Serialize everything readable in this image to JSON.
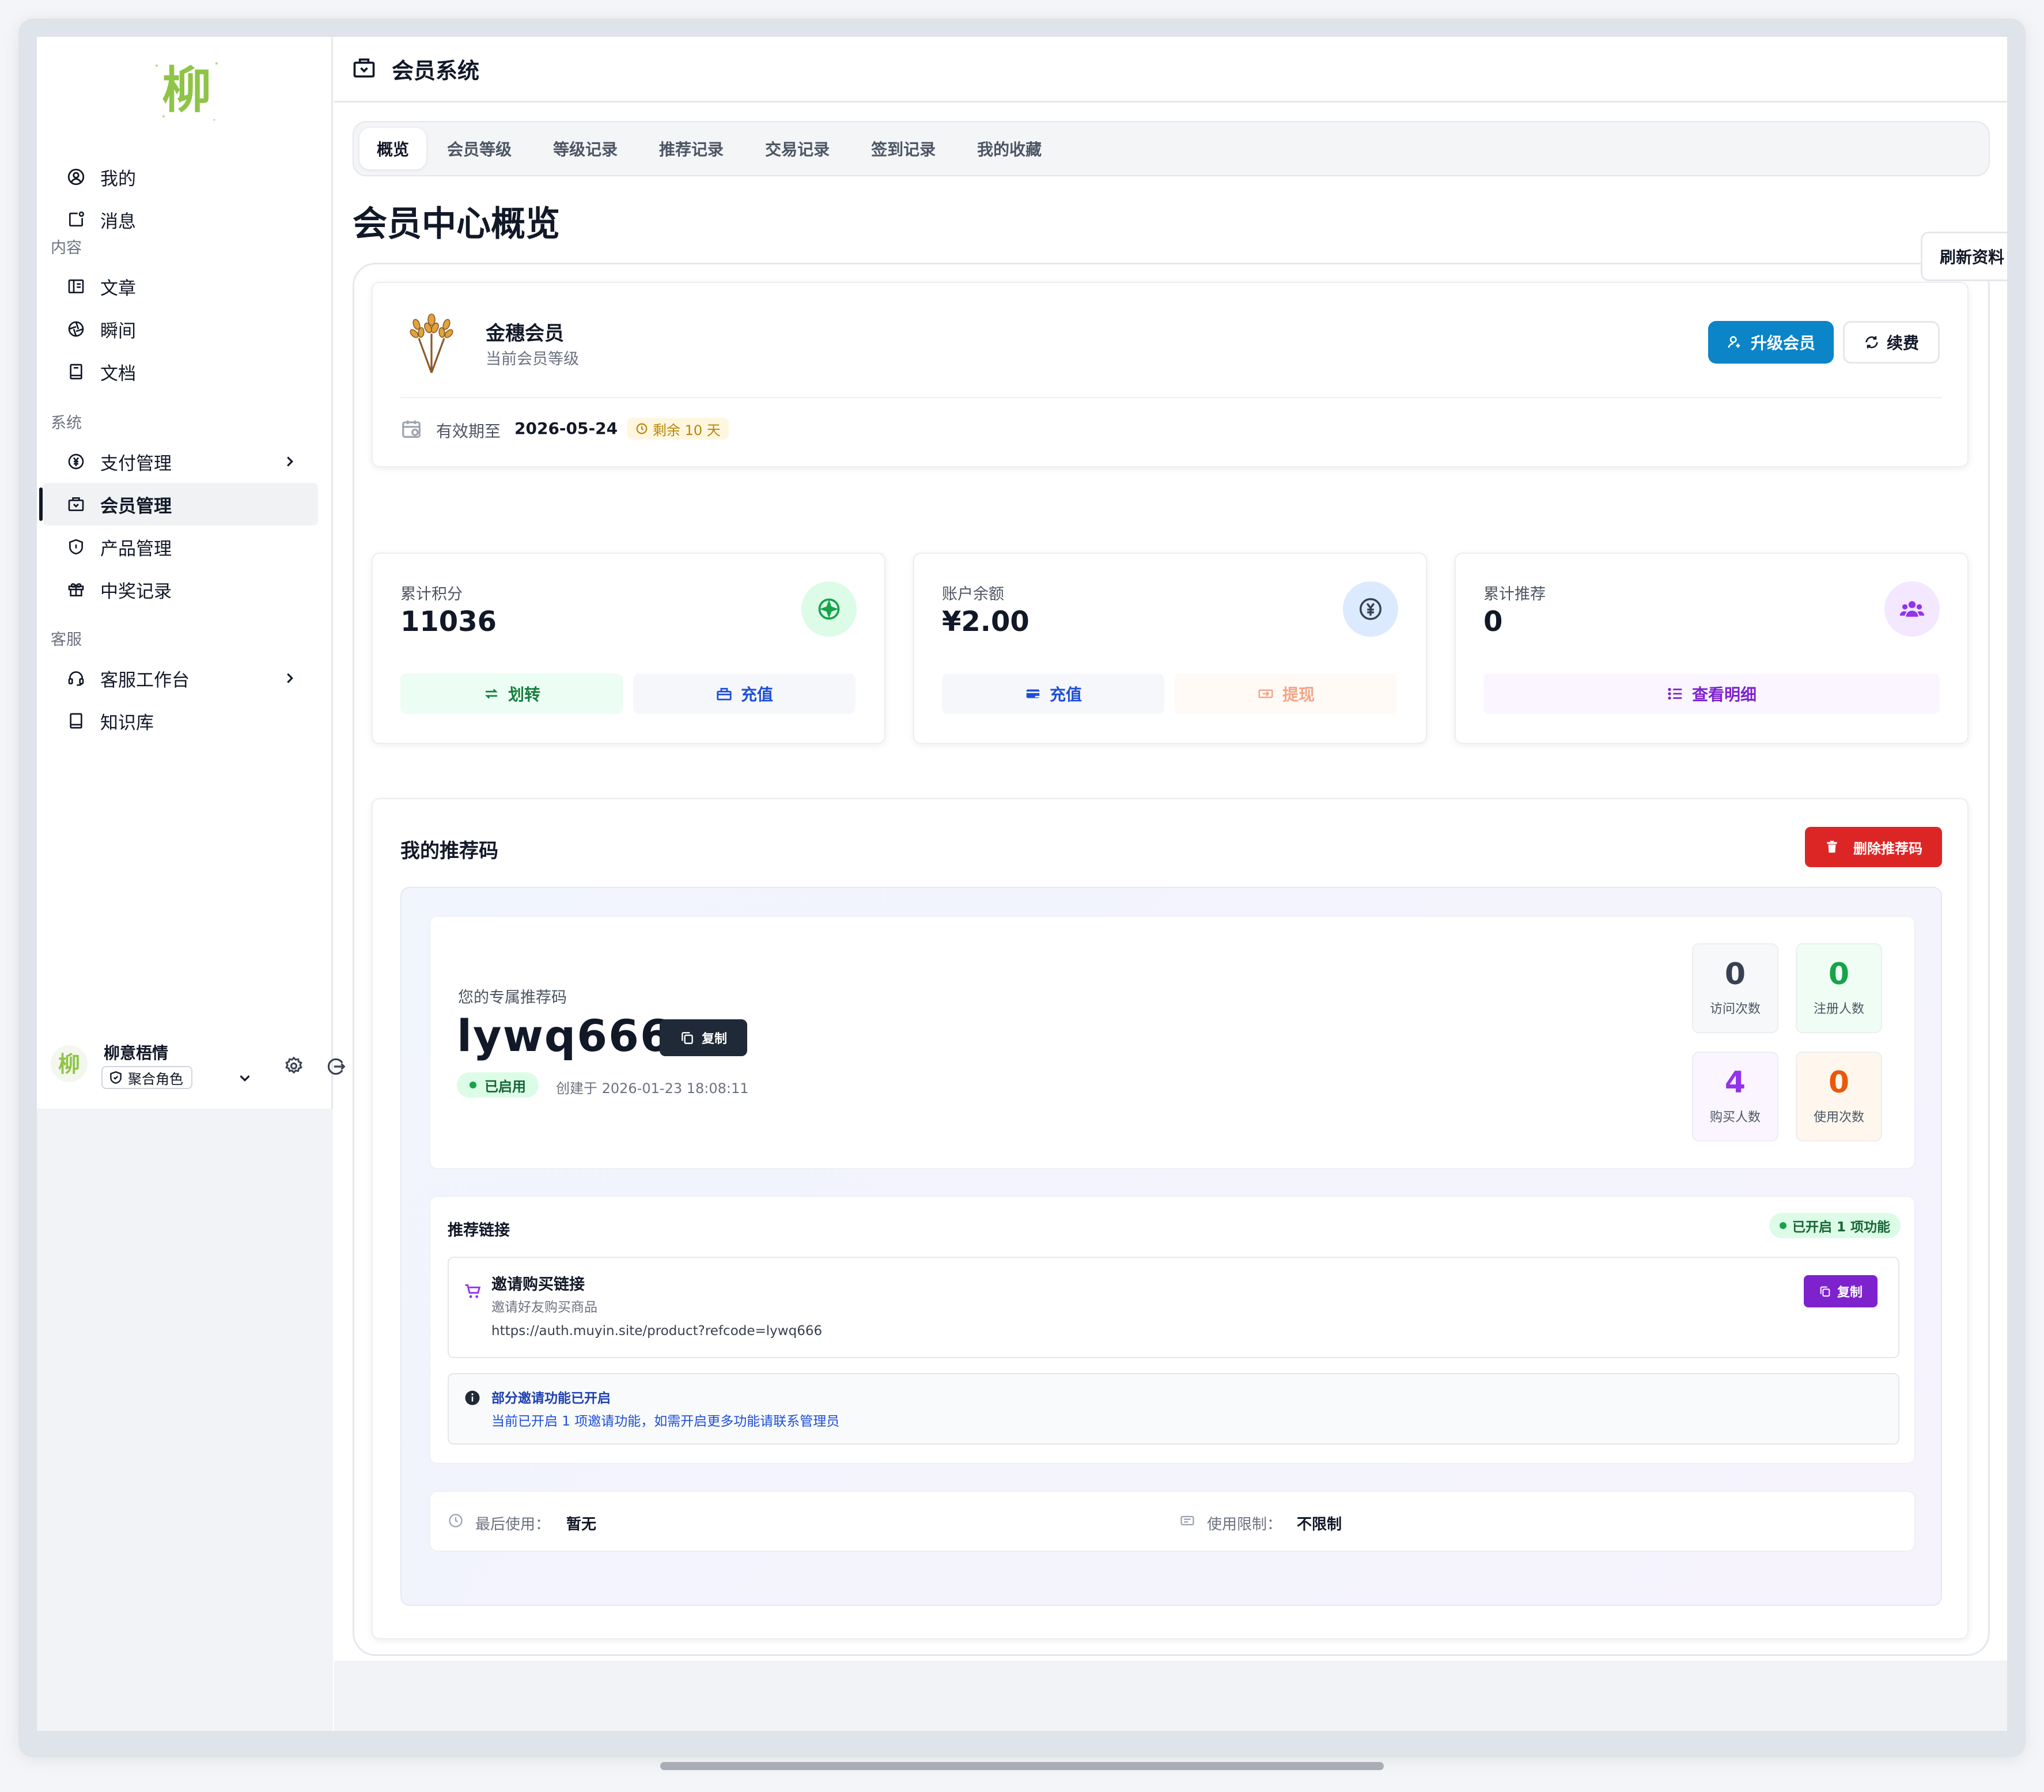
{
  "colors": {
    "accent_blue": "#0b84c8",
    "danger": "#dc2626",
    "purple": "#7e22ce",
    "green": "#16a34a",
    "orange": "#ea580c"
  },
  "sidebar": {
    "logo_char": "柳",
    "top_items": [
      {
        "label": "我的",
        "icon": "user-circle-icon"
      },
      {
        "label": "消息",
        "icon": "message-icon"
      }
    ],
    "sections": [
      {
        "label": "内容",
        "items": [
          {
            "label": "文章",
            "icon": "article-icon"
          },
          {
            "label": "瞬间",
            "icon": "moment-icon"
          },
          {
            "label": "文档",
            "icon": "book-icon"
          }
        ]
      },
      {
        "label": "系统",
        "items": [
          {
            "label": "支付管理",
            "icon": "yen-icon",
            "has_children": true
          },
          {
            "label": "会员管理",
            "icon": "member-icon",
            "active": true
          },
          {
            "label": "产品管理",
            "icon": "shield-icon"
          },
          {
            "label": "中奖记录",
            "icon": "gift-icon"
          }
        ]
      },
      {
        "label": "客服",
        "items": [
          {
            "label": "客服工作台",
            "icon": "headset-icon",
            "has_children": true
          },
          {
            "label": "知识库",
            "icon": "book-icon"
          }
        ]
      }
    ],
    "user": {
      "name": "柳意梧情",
      "role": "聚合角色"
    }
  },
  "header": {
    "title": "会员系统"
  },
  "tabs": [
    {
      "label": "概览",
      "active": true
    },
    {
      "label": "会员等级"
    },
    {
      "label": "等级记录"
    },
    {
      "label": "推荐记录"
    },
    {
      "label": "交易记录"
    },
    {
      "label": "签到记录"
    },
    {
      "label": "我的收藏"
    }
  ],
  "page": {
    "title": "会员中心概览",
    "refresh_label": "刷新资料"
  },
  "membership": {
    "level_name": "金穗会员",
    "level_sub": "当前会员等级",
    "upgrade_label": "升级会员",
    "renew_label": "续费",
    "valid_label": "有效期至",
    "valid_date": "2026-05-24",
    "remaining": "剩余 10 天"
  },
  "stats": [
    {
      "label": "累计积分",
      "value": "11036",
      "icon": "points-icon",
      "buttons": [
        {
          "label": "划转",
          "icon": "transfer-icon"
        },
        {
          "label": "充值",
          "icon": "wallet-icon"
        }
      ]
    },
    {
      "label": "账户余额",
      "value": "¥2.00",
      "icon": "yen-icon",
      "buttons": [
        {
          "label": "充值",
          "icon": "card-icon"
        },
        {
          "label": "提现",
          "icon": "withdraw-icon"
        }
      ]
    },
    {
      "label": "累计推荐",
      "value": "0",
      "icon": "users-icon",
      "buttons": [
        {
          "label": "查看明细",
          "icon": "list-icon"
        }
      ]
    }
  ],
  "referral": {
    "title": "我的推荐码",
    "delete_label": "删除推荐码",
    "code_label": "您的专属推荐码",
    "code": "lywq666",
    "copy_label": "复制",
    "status": "已启用",
    "created": "创建于 2026-01-23 18:08:11",
    "metrics": [
      {
        "value": "0",
        "label": "访问次数",
        "color": "#374151"
      },
      {
        "value": "0",
        "label": "注册人数",
        "color": "#16a34a"
      },
      {
        "value": "4",
        "label": "购买人数",
        "color": "#9333ea"
      },
      {
        "value": "0",
        "label": "使用次数",
        "color": "#ea580c"
      }
    ],
    "links": {
      "title": "推荐链接",
      "badge": "已开启 1 项功能",
      "item_title": "邀请购买链接",
      "item_sub": "邀请好友购买商品",
      "item_url": "https://auth.muyin.site/product?refcode=lywq666",
      "copy_label": "复制",
      "info_title": "部分邀请功能已开启",
      "info_text": "当前已开启 1 项邀请功能，如需开启更多功能请联系管理员"
    },
    "last_used_label": "最后使用：",
    "last_used_value": "暂无",
    "limit_label": "使用限制：",
    "limit_value": "不限制"
  }
}
